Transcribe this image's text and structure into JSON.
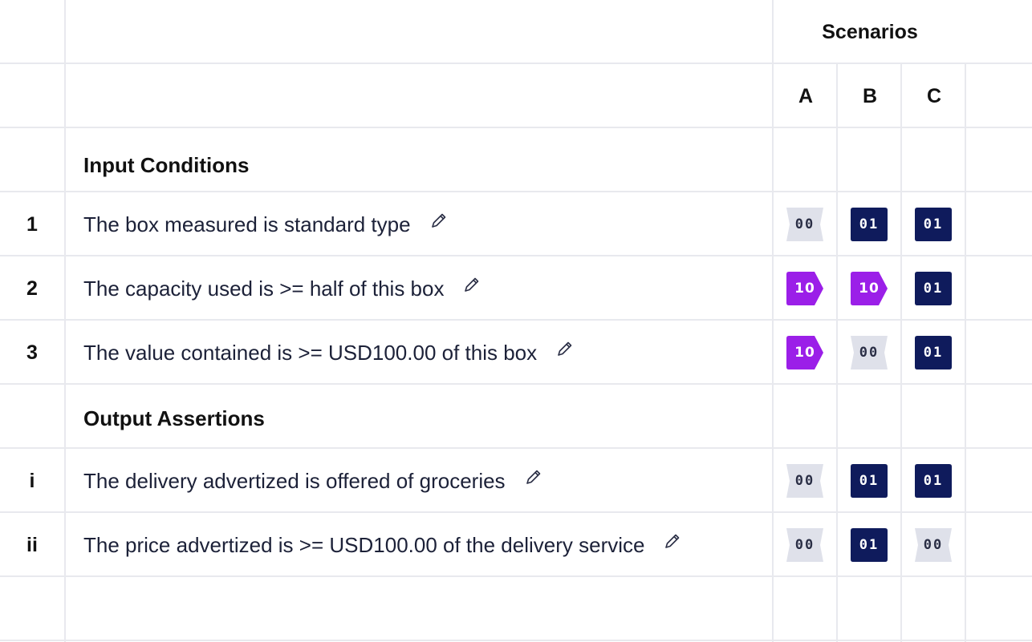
{
  "header": {
    "scenarios_title": "Scenarios",
    "columns": [
      "A",
      "B",
      "C"
    ]
  },
  "sections": {
    "input_title": "Input Conditions",
    "output_title": "Output Assertions"
  },
  "rows": [
    {
      "num": "1",
      "text": "The box measured is standard type",
      "values": [
        "00",
        "01",
        "01"
      ]
    },
    {
      "num": "2",
      "text": "The capacity used is >= half of this box",
      "values": [
        "10",
        "10",
        "01"
      ]
    },
    {
      "num": "3",
      "text": "The value contained is >= USD100.00 of this box",
      "values": [
        "10",
        "00",
        "01"
      ]
    },
    {
      "num": "i",
      "text": "The delivery advertized is offered of groceries",
      "values": [
        "00",
        "01",
        "01"
      ]
    },
    {
      "num": "ii",
      "text": "The price advertized is >= USD100.00 of the delivery service",
      "values": [
        "00",
        "01",
        "00"
      ]
    }
  ],
  "icons": {
    "edit": "pencil-icon"
  },
  "colors": {
    "badge_01": "#0f1b5c",
    "badge_10": "#9b1fe8",
    "badge_00": "#dfe1ea",
    "grid": "#e8e9ee"
  }
}
